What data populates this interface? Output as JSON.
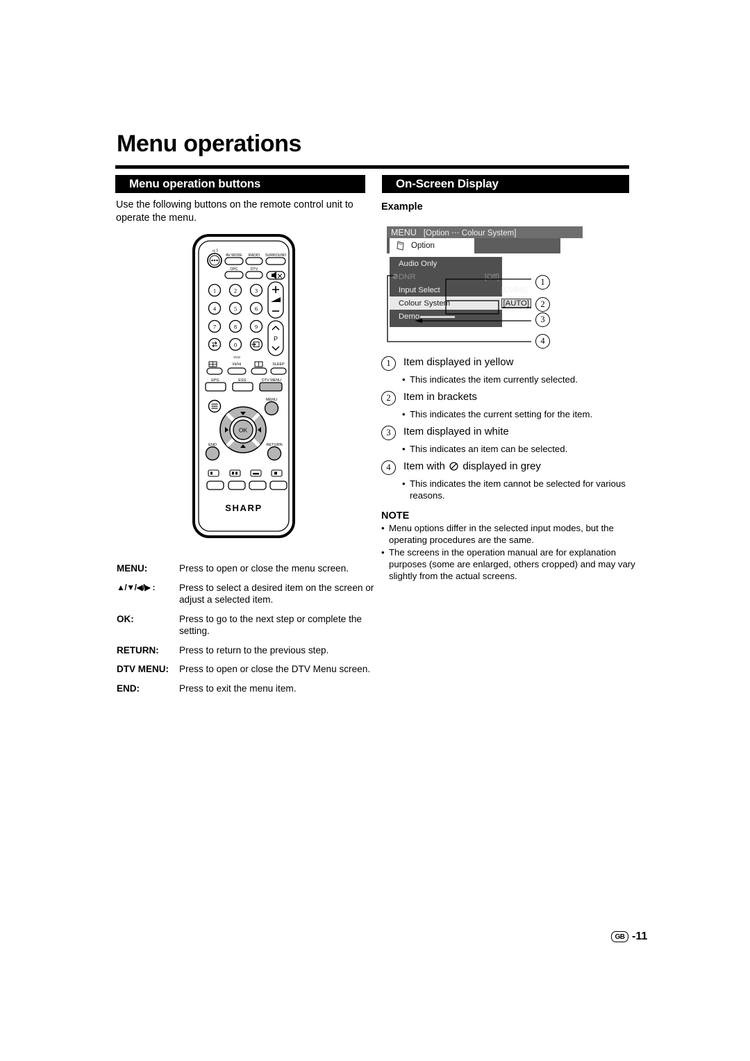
{
  "page_title": "Menu operations",
  "sections": {
    "left_header": "Menu operation buttons",
    "right_header": "On-Screen Display"
  },
  "intro": "Use the following buttons on the remote control unit to operate the menu.",
  "example_label": "Example",
  "remote": {
    "brand": "SHARP",
    "power_label": "⏻ I",
    "top_buttons": [
      "AV MODE",
      "RADIO",
      "SURROUND"
    ],
    "second_row": [
      "OPC",
      "DTV"
    ],
    "mute_icon": "mute-icon",
    "numbers": [
      "1",
      "2",
      "3",
      "4",
      "5",
      "6",
      "7",
      "8",
      "9",
      "0"
    ],
    "volume_label": "volume-rocker",
    "channel_label": "P",
    "vcd_label": "VCD",
    "vcd_sub": "I/II/I•II",
    "sleep": "SLEEP",
    "function_row": [
      "EPG",
      "ESG",
      "DTV MENU"
    ],
    "highlighted_button": "DTV MENU",
    "nav": {
      "ok": "OK",
      "menu": "MENU",
      "end": "END",
      "return": "RETURN",
      "up": "▲",
      "down": "▼",
      "left": "◀",
      "right": "▶"
    }
  },
  "button_table": [
    {
      "key": "MENU:",
      "desc": "Press to open or close the menu screen."
    },
    {
      "key": "▲/▼/◀/▶ :",
      "desc": "Press to select a desired item on the screen or adjust a selected item."
    },
    {
      "key": "OK:",
      "desc": "Press to go to the next step or complete the setting."
    },
    {
      "key": "RETURN:",
      "desc": "Press to return to the previous step."
    },
    {
      "key": "DTV MENU:",
      "desc": "Press to open or close the DTV Menu screen."
    },
    {
      "key": "END:",
      "desc": "Press to exit the menu item."
    }
  ],
  "osd": {
    "menu_word": "MENU",
    "breadcrumb": "[Option ⋯ Colour System]",
    "tab_label": "Option",
    "tab_icon": "option-icon",
    "items": [
      {
        "label": "Audio Only",
        "value": "",
        "state": "normal"
      },
      {
        "label": "DNR",
        "value": "[Off]",
        "state": "disabled",
        "icon": "prohibited-icon"
      },
      {
        "label": "Input Select",
        "value": "[CVBS]",
        "state": "normal"
      },
      {
        "label": "Colour System",
        "value": "[AUTO]",
        "state": "selected"
      },
      {
        "label": "Demo",
        "value": "",
        "state": "normal"
      }
    ]
  },
  "callouts": [
    "1",
    "2",
    "3",
    "4"
  ],
  "explanations": [
    {
      "num": "1",
      "title": "Item displayed in yellow",
      "bullet": "This indicates the item currently selected."
    },
    {
      "num": "2",
      "title": "Item in brackets",
      "bullet": "This indicates the current setting for the item."
    },
    {
      "num": "3",
      "title": "Item displayed in white",
      "bullet": "This indicates an item can be selected."
    },
    {
      "num": "4",
      "title_before": "Item with",
      "title_after": "displayed in grey",
      "bullet": "This indicates the item cannot be selected for various reasons."
    }
  ],
  "note": {
    "heading": "NOTE",
    "items": [
      "Menu options differ in the selected input modes, but the operating procedures are the same.",
      "The screens in the operation manual are for explanation purposes (some are enlarged, others cropped) and may vary slightly from the actual screens."
    ]
  },
  "footer": {
    "region": "GB",
    "page": "-11"
  }
}
